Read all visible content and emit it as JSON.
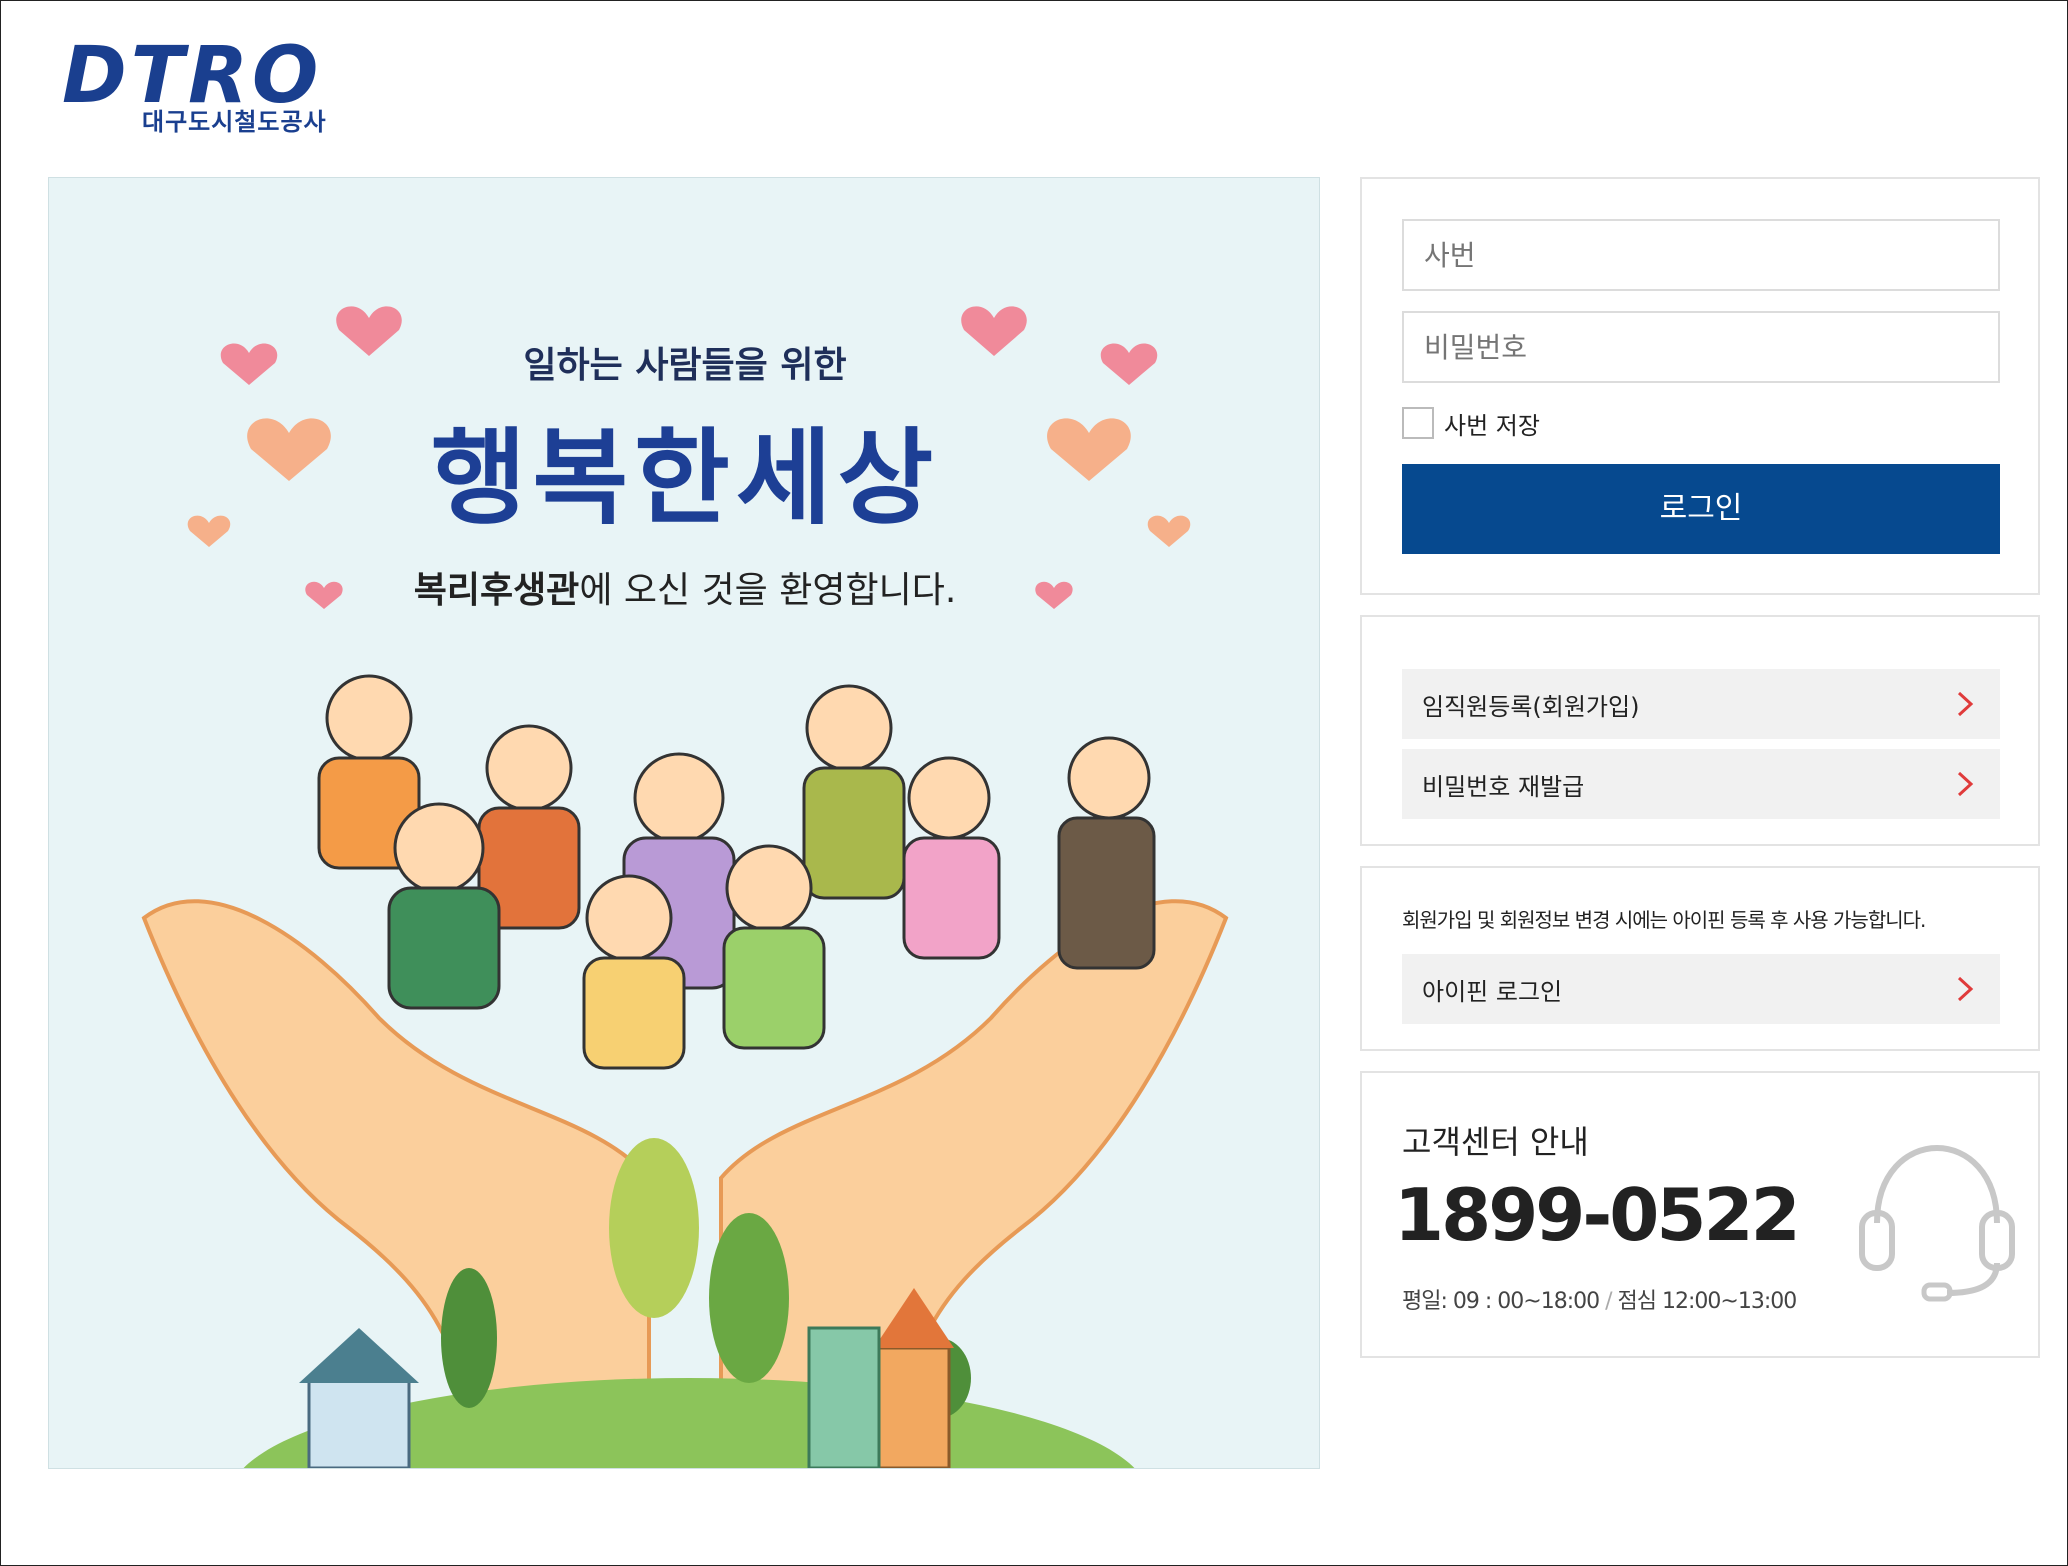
{
  "logo": {
    "word": "DTRO",
    "subtitle": "대구도시철도공사"
  },
  "hero": {
    "subtitle": "일하는 사람들을 위한",
    "title": "행복한세상",
    "welcome_bold": "복리후생관",
    "welcome_rest": "에 오신 것을 환영합니다."
  },
  "login": {
    "id_placeholder": "사번",
    "pw_placeholder": "비밀번호",
    "remember_label": "사번 저장",
    "login_button": "로그인"
  },
  "links": {
    "register": "임직원등록(회원가입)",
    "reset_password": "비밀번호 재발급"
  },
  "ipin": {
    "note": "회원가입 및 회원정보 변경 시에는 아이핀 등록 후 사용 가능합니다.",
    "button": "아이핀 로그인"
  },
  "customer_center": {
    "title": "고객센터 안내",
    "phone": "1899-0522",
    "hours_weekday": "평일: 09 : 00~18:00",
    "hours_separator": "/",
    "hours_lunch": "점심 12:00~13:00"
  },
  "colors": {
    "brand_blue": "#06498f",
    "chevron_red": "#e03b3b",
    "hero_bg": "#e8f4f6"
  },
  "icons": [
    "chevron-right-icon",
    "headset-icon",
    "heart-icon"
  ]
}
